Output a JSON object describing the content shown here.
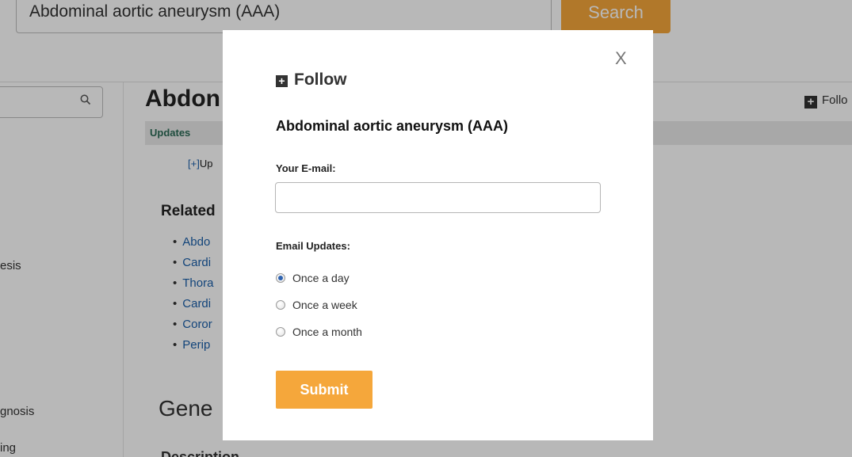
{
  "background_page": {
    "top_search": {
      "value": "Abdominal aortic aneurysm (AAA)",
      "button_label": "Search"
    },
    "sidebar": {
      "search_icon": "search-icon",
      "visible_item_fragments": [
        "esis",
        "gnosis",
        "ing"
      ]
    },
    "main": {
      "title_fragment": "Abdon",
      "tab_label": "Updates",
      "expand_toggle": "[+]",
      "expand_text_fragment": "Up",
      "related_heading_fragment": "Related",
      "related_items_fragments": [
        "Abdo",
        "Cardi",
        "Thora",
        "Cardi",
        "Coror",
        "Perip"
      ],
      "gene_heading_fragment": "Gene",
      "description_heading_fragment": "Description"
    },
    "follow_link_fragment": "Follo"
  },
  "modal": {
    "close_label": "X",
    "title": "Follow",
    "topic": "Abdominal aortic aneurysm (AAA)",
    "email_label": "Your E-mail:",
    "email_value": "",
    "updates_label": "Email Updates:",
    "frequency_options": [
      {
        "label": "Once a day",
        "checked": true
      },
      {
        "label": "Once a week",
        "checked": false
      },
      {
        "label": "Once a month",
        "checked": false
      }
    ],
    "submit_label": "Submit"
  },
  "colors": {
    "accent_orange": "#f5a73b",
    "link_blue": "#1a5faa",
    "tab_green": "#2b6b57",
    "overlay": "rgba(0,0,0,0.28)"
  }
}
